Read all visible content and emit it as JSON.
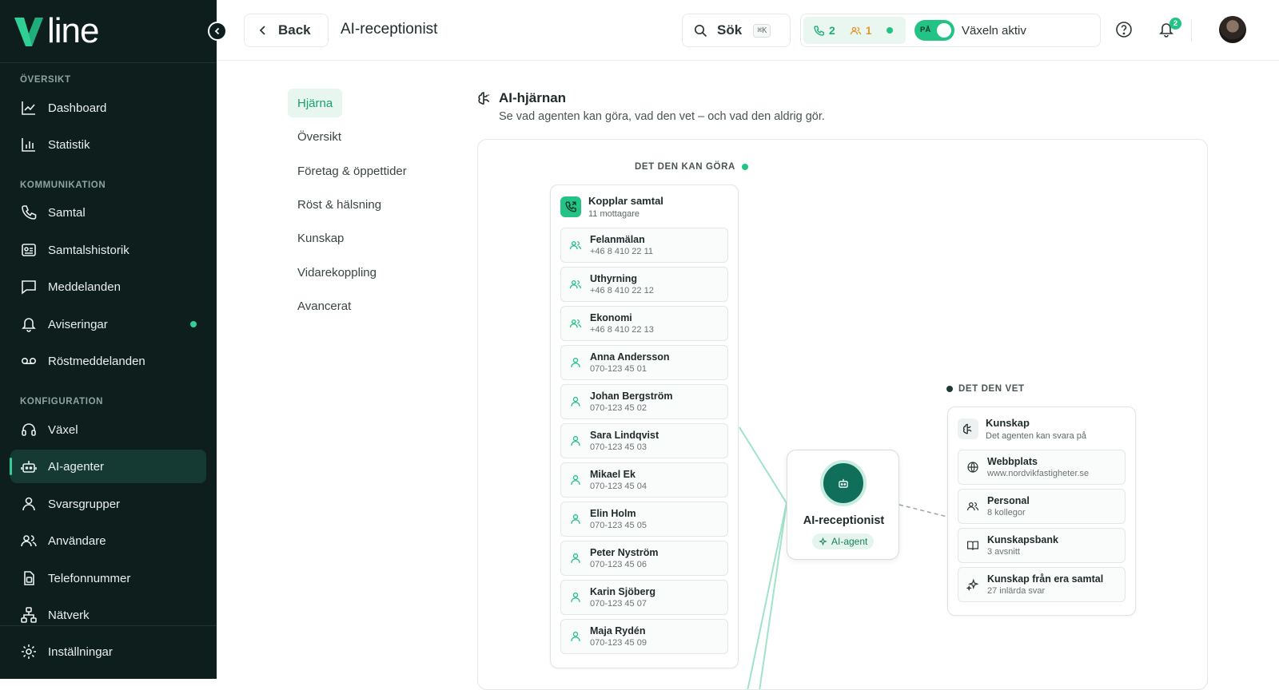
{
  "brand": {
    "logo_text": "line"
  },
  "sidebar": {
    "sections": [
      {
        "label": "ÖVERSIKT",
        "items": [
          {
            "label": "Dashboard",
            "icon": "chart-line-icon"
          },
          {
            "label": "Statistik",
            "icon": "bar-chart-icon"
          }
        ]
      },
      {
        "label": "KOMMUNIKATION",
        "items": [
          {
            "label": "Samtal",
            "icon": "phone-icon"
          },
          {
            "label": "Samtalshistorik",
            "icon": "call-history-icon"
          },
          {
            "label": "Meddelanden",
            "icon": "message-icon"
          },
          {
            "label": "Aviseringar",
            "icon": "bell-icon",
            "dot": true
          },
          {
            "label": "Röstmeddelanden",
            "icon": "voicemail-icon"
          }
        ]
      },
      {
        "label": "KONFIGURATION",
        "items": [
          {
            "label": "Växel",
            "icon": "headset-icon"
          },
          {
            "label": "AI-agenter",
            "icon": "robot-icon",
            "active": true
          },
          {
            "label": "Svarsgrupper",
            "icon": "user-icon"
          },
          {
            "label": "Användare",
            "icon": "users-icon"
          },
          {
            "label": "Telefonnummer",
            "icon": "sim-icon"
          },
          {
            "label": "Nätverk",
            "icon": "network-icon"
          }
        ]
      }
    ],
    "footer_item": {
      "label": "Inställningar",
      "icon": "gear-icon"
    }
  },
  "topbar": {
    "back_label": "Back",
    "page_title": "AI-receptionist",
    "search_label": "Sök",
    "search_shortcut": "⌘K",
    "active_calls": "2",
    "waiting_users": "1",
    "toggle_text": "PÅ",
    "switch_label": "Växeln aktiv",
    "notification_count": "2"
  },
  "subnav": [
    "Hjärna",
    "Översikt",
    "Företag & öppettider",
    "Röst & hälsning",
    "Kunskap",
    "Vidarekoppling",
    "Avancerat"
  ],
  "content": {
    "title": "AI-hjärnan",
    "subtitle": "Se vad agenten kan göra, vad den vet – och vad den aldrig gör."
  },
  "colors": {
    "sidebar_bg": "#0d1e1d",
    "accent": "#22c384",
    "agent_orb": "#0f6f5a"
  },
  "brain": {
    "can_do": {
      "label": "DET DEN KAN GÖRA",
      "card_title": "Kopplar samtal",
      "card_sub": "11 mottagare",
      "items": [
        {
          "title": "Felanmälan",
          "sub": "+46 8 410 22 11",
          "icon": "group-icon"
        },
        {
          "title": "Uthyrning",
          "sub": "+46 8 410 22 12",
          "icon": "group-icon"
        },
        {
          "title": "Ekonomi",
          "sub": "+46 8 410 22 13",
          "icon": "group-icon"
        },
        {
          "title": "Anna Andersson",
          "sub": "070-123 45 01",
          "icon": "person-icon"
        },
        {
          "title": "Johan Bergström",
          "sub": "070-123 45 02",
          "icon": "person-icon"
        },
        {
          "title": "Sara Lindqvist",
          "sub": "070-123 45 03",
          "icon": "person-icon"
        },
        {
          "title": "Mikael Ek",
          "sub": "070-123 45 04",
          "icon": "person-icon"
        },
        {
          "title": "Elin Holm",
          "sub": "070-123 45 05",
          "icon": "person-icon"
        },
        {
          "title": "Peter Nyström",
          "sub": "070-123 45 06",
          "icon": "person-icon"
        },
        {
          "title": "Karin Sjöberg",
          "sub": "070-123 45 07",
          "icon": "person-icon"
        },
        {
          "title": "Maja Rydén",
          "sub": "070-123 45 09",
          "icon": "person-icon"
        }
      ]
    },
    "agent": {
      "name": "AI-receptionist",
      "tag": "AI-agent"
    },
    "knows": {
      "label": "DET DEN VET",
      "card_title": "Kunskap",
      "card_sub": "Det agenten kan svara på",
      "items": [
        {
          "title": "Webbplats",
          "sub": "www.nordvikfastigheter.se",
          "icon": "globe-icon"
        },
        {
          "title": "Personal",
          "sub": "8 kollegor",
          "icon": "group-icon"
        },
        {
          "title": "Kunskapsbank",
          "sub": "3 avsnitt",
          "icon": "book-icon"
        },
        {
          "title": "Kunskap från era samtal",
          "sub": "27 inlärda svar",
          "icon": "sparkle-icon"
        }
      ]
    }
  }
}
